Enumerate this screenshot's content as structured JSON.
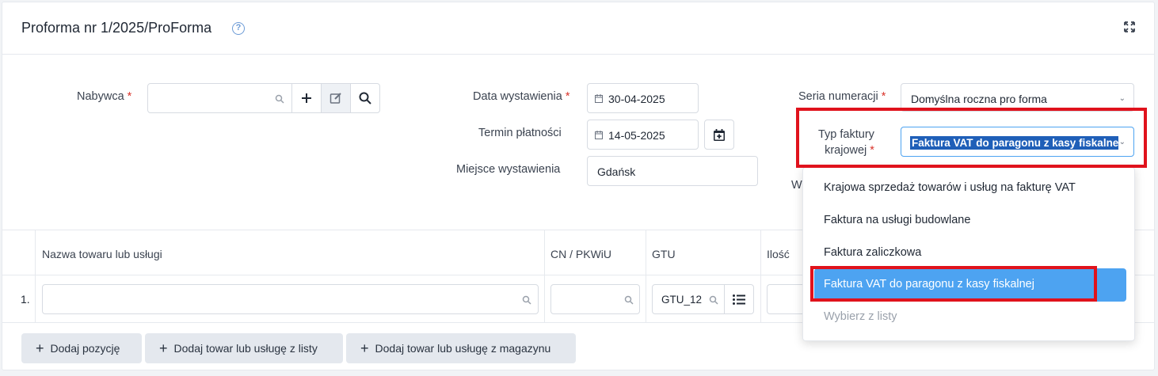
{
  "header": {
    "title": "Proforma nr 1/2025/ProForma",
    "help": "?"
  },
  "form": {
    "buyer_label": "Nabywca",
    "required_mark": "*",
    "issue_date_label": "Data wystawienia",
    "issue_date_value": "30-04-2025",
    "due_date_label": "Termin płatności",
    "due_date_value": "14-05-2025",
    "place_label": "Miejsce wystawienia",
    "place_value": "Gdańsk",
    "series_label": "Seria numeracji",
    "series_value": "Domyślna roczna pro forma",
    "invoice_type_label_line1": "Typ faktury",
    "invoice_type_label_line2": "krajowej",
    "invoice_type_value": "Faktura VAT do paragonu z kasy fiskalnej",
    "hidden_label_partial": "W"
  },
  "table": {
    "columns": [
      "Nazwa towaru lub usługi",
      "CN / PKWiU",
      "GTU",
      "Ilość"
    ],
    "rows": [
      {
        "number": "1.",
        "gtu": "GTU_12"
      }
    ]
  },
  "actions": {
    "add_position": "Dodaj pozycję",
    "add_from_list": "Dodaj towar lub usługę z listy",
    "add_from_warehouse": "Dodaj towar lub usługę z magazynu"
  },
  "dropdown": {
    "options": [
      "Krajowa sprzedaż towarów i usług na fakturę VAT",
      "Faktura na usługi budowlane",
      "Faktura zaliczkowa",
      "Faktura VAT do paragonu z kasy fiskalnej",
      "Wybierz z listy"
    ],
    "selected_index": 3
  },
  "colors": {
    "accent": "#4da3f1",
    "highlight": "#e0121c",
    "required": "#d9342b"
  }
}
